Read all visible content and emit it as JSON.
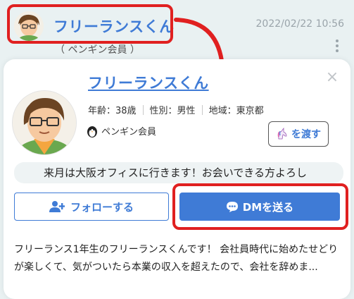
{
  "background_post": {
    "user_name": "フリーランスくん",
    "date": "2022/02/22 10:56",
    "badge_text": "（ ペンギン会員 ）"
  },
  "profile_card": {
    "user_name": "フリーランスくん",
    "age": "年齢：38歳",
    "gender": "性別：男性",
    "region": "地域：東京都",
    "member_type": "ペンギン会員",
    "give_button": "を渡す",
    "status_message": "来月は大阪オフィスに行きます！お会いできる方よろし",
    "follow_button": "フォローする",
    "dm_button": "DMを送る",
    "bio": "フリーランス1年生のフリーランスくんです！ 会社員時代に始めたせどりが楽しくて、気がついたら本業の収入を超えたので、会社を辞めま..."
  },
  "colors": {
    "accent": "#3f7bd6",
    "annotation": "#e02020",
    "background": "#e9f1f2"
  },
  "icons": [
    "close-icon",
    "penguin-icon",
    "unicorn-icon",
    "add-user-icon",
    "chat-bubble-icon",
    "more-icon",
    "arrow-icon"
  ]
}
